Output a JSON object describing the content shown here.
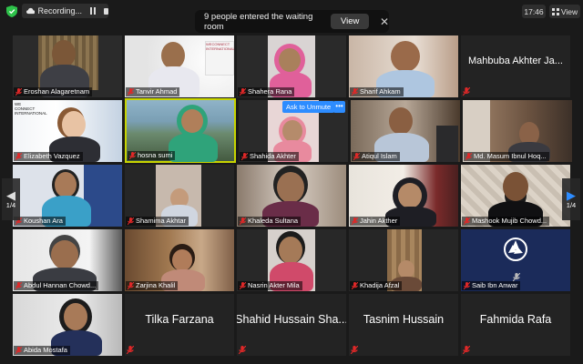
{
  "topbar": {
    "recording_label": "Recording...",
    "waiting_text": "9 people entered the waiting room",
    "view_button": "View",
    "close_glyph": "✕",
    "clock": "17:46",
    "view_menu": "View"
  },
  "nav": {
    "page": "1/4",
    "left_arrow": "◀",
    "right_arrow": "▶"
  },
  "overlay": {
    "unmute_button": "Ask to Unmute",
    "more_button": "•••"
  },
  "participants": [
    {
      "name": "Eroshan Alagaretnam"
    },
    {
      "name": "Tanvir Ahmad"
    },
    {
      "name": "Shahera Rana"
    },
    {
      "name": "Sharif Ahkam"
    },
    {
      "name": "Mahbuba Akhter Ja..."
    },
    {
      "name": "Elizabeth Vazquez"
    },
    {
      "name": "hosna sumi"
    },
    {
      "name": "Shahida Akhter"
    },
    {
      "name": "Atiqul Islam"
    },
    {
      "name": "Md. Masum Ibnul Hoq..."
    },
    {
      "name": "Koushan Ara"
    },
    {
      "name": "Shamima Akhtar"
    },
    {
      "name": "Khaleda Sultana"
    },
    {
      "name": "Jahin Akther"
    },
    {
      "name": "Mashook Mujib Chowd..."
    },
    {
      "name": "Abdul Hannan Chowd..."
    },
    {
      "name": "Zarjina Khalil"
    },
    {
      "name": "Nasrin Akter Mila"
    },
    {
      "name": "Khadija Afzal"
    },
    {
      "name": "Saib Ibn Anwar"
    },
    {
      "name": "Abida Mostafa"
    },
    {
      "name": "Tilka Farzana"
    },
    {
      "name": "Shahid Hussain Sha..."
    },
    {
      "name": "Tasnim Hussain"
    },
    {
      "name": "Fahmida Rafa"
    }
  ],
  "colors": {
    "muted_mic": "#e02828",
    "accent_blue": "#2d8cff",
    "active_speaker": "#c8d400"
  }
}
